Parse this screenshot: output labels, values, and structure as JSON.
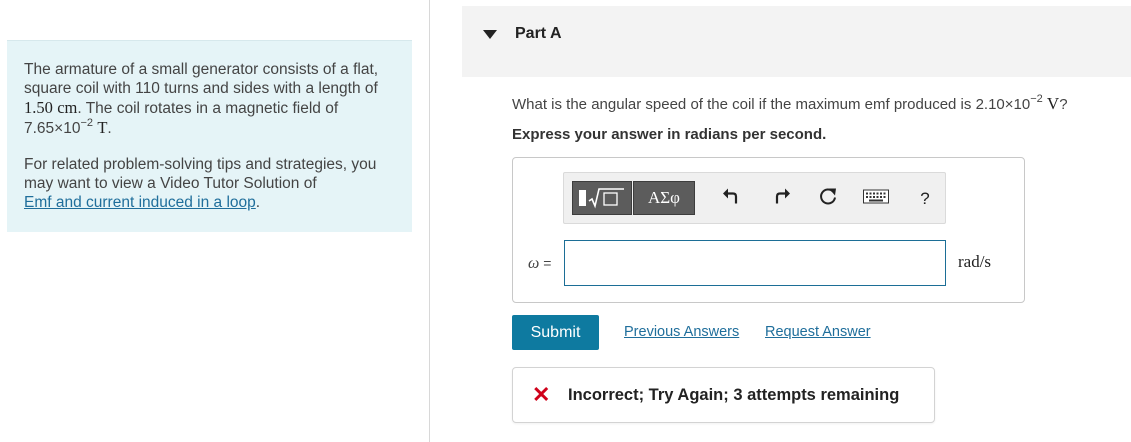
{
  "problem": {
    "text_before_length": "The armature of a small generator consists of a flat, square coil with 110 turns and sides with a length of",
    "length_value": "1.50",
    "length_unit": "cm",
    "text_before_field": ". The coil rotates in a magnetic field of",
    "field_mantissa": "7.65×10",
    "field_exponent": "−2",
    "field_unit": "T",
    "field_end": ".",
    "tips_text": "For related problem-solving tips and strategies, you may want to view a Video Tutor Solution of",
    "tips_link": "Emf and current induced in a loop",
    "tips_end": "."
  },
  "part": {
    "title": "Part A",
    "question_text": "What is the angular speed of the coil if the maximum emf produced is",
    "emf_mantissa": "2.10×10",
    "emf_exponent": "−2",
    "emf_unit": "V",
    "question_end": "?",
    "instruction": "Express your answer in radians per second."
  },
  "toolbar": {
    "greek_label": "ΑΣφ",
    "help_label": "?",
    "icons": [
      "templates-icon",
      "greek-letters-icon",
      "undo-icon",
      "redo-icon",
      "reset-icon",
      "keyboard-icon",
      "help-icon"
    ]
  },
  "answer": {
    "variable_symbol": "ω",
    "equals": "=",
    "value": "",
    "unit": "rad/s"
  },
  "actions": {
    "submit_label": "Submit",
    "previous_answers_label": "Previous Answers",
    "request_answer_label": "Request Answer"
  },
  "feedback": {
    "message": "Incorrect; Try Again; 3 attempts remaining"
  },
  "colors": {
    "problem_bg": "#e5f4f7",
    "link": "#1f6e9b",
    "submit_bg": "#0e7aa0",
    "input_border": "#1c6e96",
    "error": "#d0021b"
  }
}
